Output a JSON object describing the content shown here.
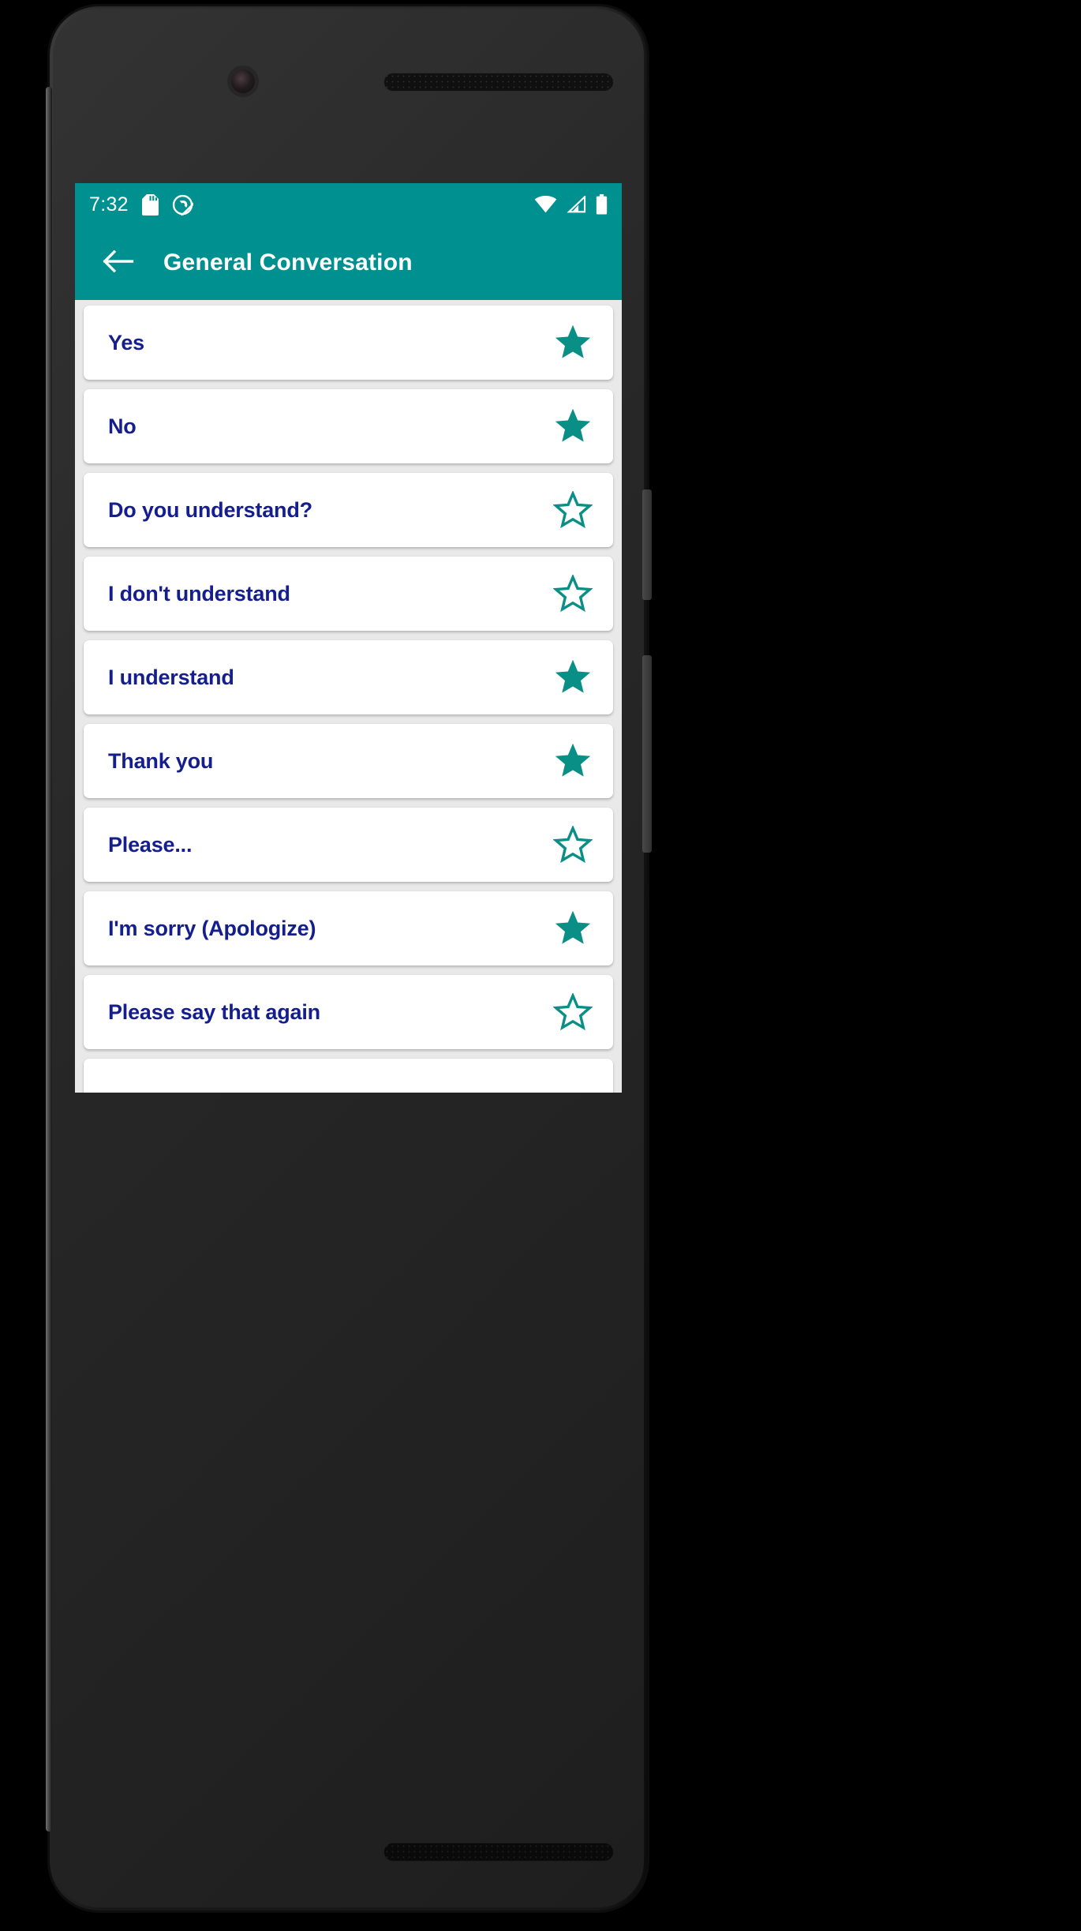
{
  "status_bar": {
    "time": "7:32",
    "left_icons": [
      "sd-card-icon",
      "do-not-disturb-icon"
    ],
    "right_icons": [
      "wifi-icon",
      "cell-signal-icon",
      "battery-icon"
    ],
    "background_color": "#009090",
    "foreground_color": "#ffffff"
  },
  "app_bar": {
    "back_icon": "back-arrow-icon",
    "title": "General Conversation",
    "background_color": "#009090",
    "title_color": "#ffffff"
  },
  "theme": {
    "accent_teal": "#009090",
    "star_teal": "#0a8f86",
    "label_navy": "#141e8c",
    "card_background": "#ffffff",
    "list_background": "#e9e9e9"
  },
  "phrases": [
    {
      "label": "Yes",
      "favorite": true,
      "star_icon": "star-filled-icon"
    },
    {
      "label": "No",
      "favorite": true,
      "star_icon": "star-filled-icon"
    },
    {
      "label": "Do you understand?",
      "favorite": false,
      "star_icon": "star-outline-icon"
    },
    {
      "label": "I don't understand",
      "favorite": false,
      "star_icon": "star-outline-icon"
    },
    {
      "label": "I understand",
      "favorite": true,
      "star_icon": "star-filled-icon"
    },
    {
      "label": "Thank you",
      "favorite": true,
      "star_icon": "star-filled-icon"
    },
    {
      "label": "Please...",
      "favorite": false,
      "star_icon": "star-outline-icon"
    },
    {
      "label": "I'm sorry (Apologize)",
      "favorite": true,
      "star_icon": "star-filled-icon"
    },
    {
      "label": "Please say that again",
      "favorite": false,
      "star_icon": "star-outline-icon"
    },
    {
      "label": "",
      "favorite": false,
      "star_icon": "star-outline-icon"
    }
  ],
  "nav_bar": {
    "items": [
      {
        "name": "back-nav-button",
        "icon": "triangle-back-icon"
      },
      {
        "name": "home-nav-button",
        "icon": "circle-home-icon"
      },
      {
        "name": "recents-nav-button",
        "icon": "square-recents-icon"
      }
    ],
    "background_color": "#000000",
    "icon_color": "#9e9e9e"
  }
}
